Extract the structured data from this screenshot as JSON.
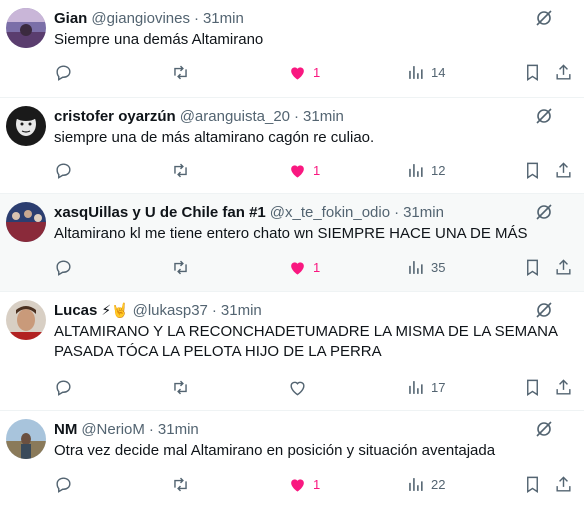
{
  "tweets": [
    {
      "name": "Gian",
      "emoji": "",
      "handle": "@giangiovines",
      "time": "31min",
      "text": "Siempre una demás Altamirano",
      "likes": "1",
      "views": "14",
      "highlight": false
    },
    {
      "name": "cristofer oyarzún",
      "emoji": "",
      "handle": "@aranguista_20",
      "time": "31min",
      "text": "siempre una de más altamirano cagón re culiao.",
      "likes": "1",
      "views": "12",
      "highlight": false
    },
    {
      "name": "xasqUillas y U de Chile fan #1",
      "emoji": "",
      "handle": "@x_te_fokin_odio",
      "time": "31min",
      "text": "Altamirano kl me tiene entero chato wn SIEMPRE HACE UNA DE MÁS",
      "likes": "1",
      "views": "35",
      "highlight": true
    },
    {
      "name": "Lucas",
      "emoji": "⚡🤘",
      "handle": "@lukasp37",
      "time": "31min",
      "text": "ALTAMIRANO Y LA RECONCHADETUMADRE LA MISMA DE LA SEMANA PASADA TÓCA LA PELOTA HIJO DE LA PERRA",
      "likes": "",
      "views": "17",
      "highlight": false
    },
    {
      "name": "NM",
      "emoji": "",
      "handle": "@NerioM",
      "time": "31min",
      "text": "Otra vez decide mal Altamirano en posición y situación aventajada",
      "likes": "1",
      "views": "22",
      "highlight": false
    }
  ],
  "icons": {
    "reply": "reply-icon",
    "retweet": "retweet-icon",
    "like": "heart-icon",
    "views": "views-icon",
    "bookmark": "bookmark-icon",
    "share": "share-icon",
    "grok": "grok-icon"
  },
  "colors": {
    "like_active": "#f91880",
    "muted": "#536471",
    "text": "#0f1419",
    "highlight_bg": "#f7f9f9"
  }
}
